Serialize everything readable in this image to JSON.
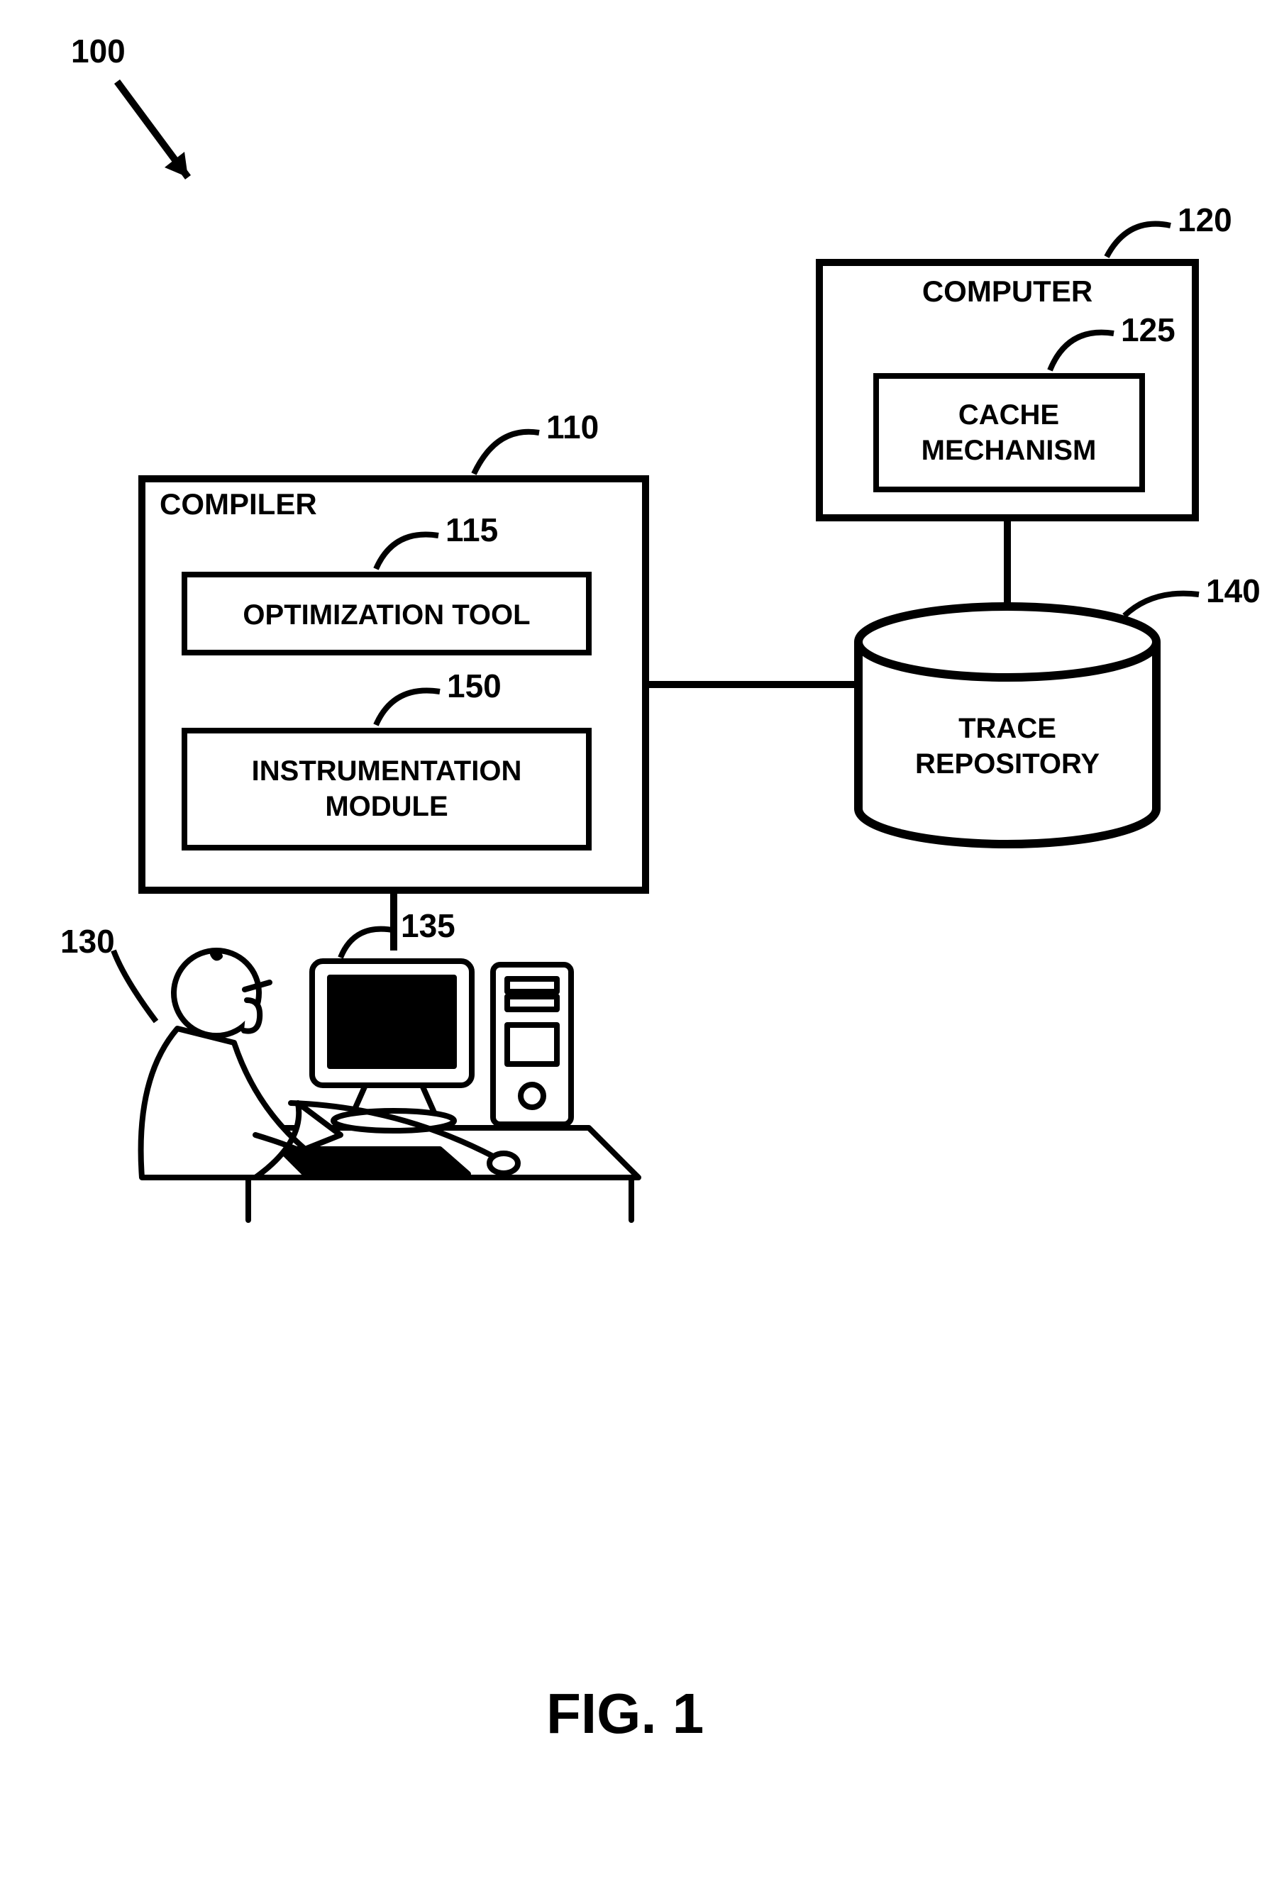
{
  "refs": {
    "figure": "100",
    "compiler": "110",
    "optTool": "115",
    "computer": "120",
    "cache": "125",
    "user": "130",
    "terminal": "135",
    "repo": "140",
    "instrument": "150"
  },
  "labels": {
    "compiler": "COMPILER",
    "optTool": "OPTIMIZATION TOOL",
    "instrument": "INSTRUMENTATION\nMODULE",
    "computer": "COMPUTER",
    "cache": "CACHE\nMECHANISM",
    "repo": "TRACE\nREPOSITORY"
  },
  "caption": "FIG. 1"
}
